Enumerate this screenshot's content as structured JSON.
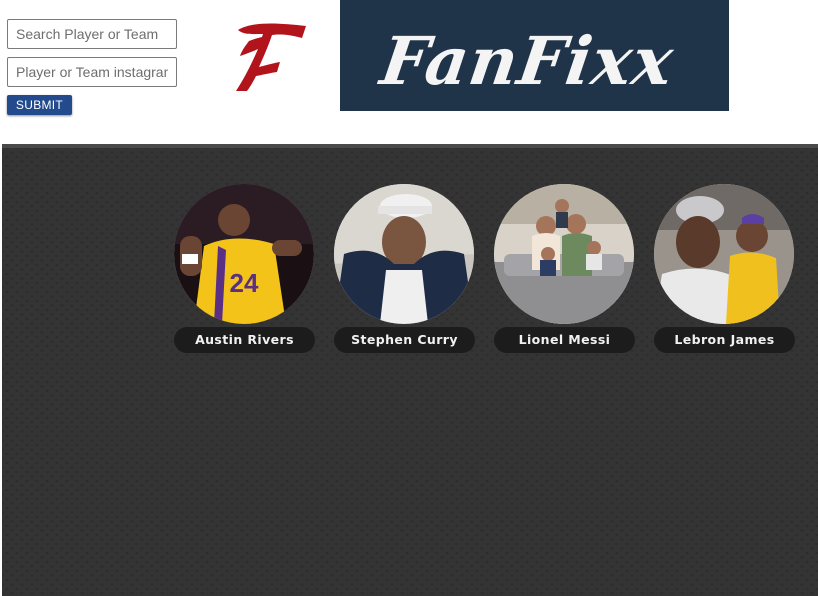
{
  "search": {
    "player_placeholder": "Search Player or Team",
    "instagram_placeholder": "Player or Team instagram",
    "submit_label": "SUBMIT"
  },
  "brand": {
    "wordmark": "FanFixx",
    "mark": "F",
    "mark_color": "#b2141c",
    "banner_color": "#1f3349"
  },
  "theme": {
    "background_pattern": "dark-hexagon",
    "accent": "#234a8c"
  },
  "players": [
    {
      "name": "Austin Rivers",
      "photo": "player-in-yellow-24-jersey-celebrating"
    },
    {
      "name": "Stephen Curry",
      "photo": "man-in-white-cap-and-navy-jacket"
    },
    {
      "name": "Lionel Messi",
      "photo": "family-on-gray-couch"
    },
    {
      "name": "Lebron James",
      "photo": "man-in-cap-with-child-in-yellow-jersey"
    }
  ]
}
